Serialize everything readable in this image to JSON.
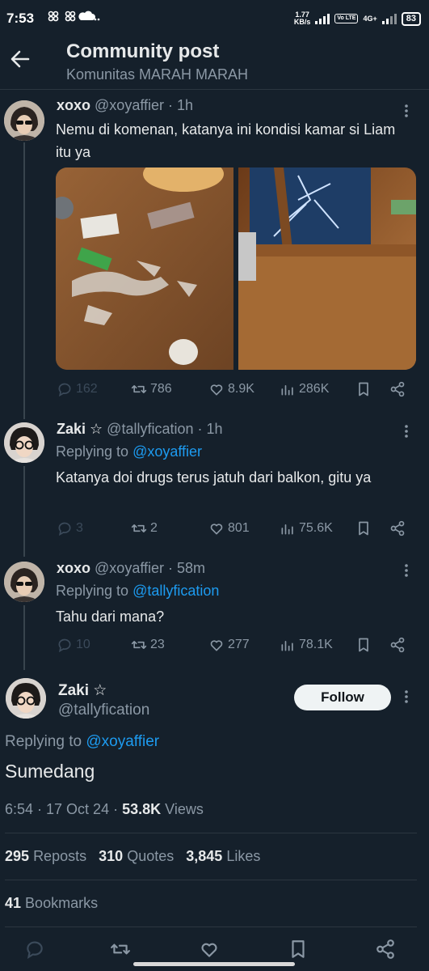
{
  "status_bar": {
    "time": "7:53",
    "speed_value": "1.77",
    "speed_unit": "KB/s",
    "network": "4G+",
    "volte": "Vo LTE",
    "battery": "83"
  },
  "header": {
    "title": "Community post",
    "subtitle": "Komunitas MARAH MARAH"
  },
  "posts": [
    {
      "name": "xoxo",
      "handle": "@xoyaffier",
      "time": "· 1h",
      "text": "Nemu di komenan, katanya ini kondisi kamar si Liam itu ya",
      "stats": {
        "replies": "162",
        "reposts": "786",
        "likes": "8.9K",
        "views": "286K"
      }
    },
    {
      "name": "Zaki ☆",
      "handle": "@tallyfication",
      "time": "· 1h",
      "replying_label": "Replying to",
      "replying_to": "@xoyaffier",
      "text": "Katanya doi drugs terus jatuh dari balkon, gitu ya",
      "stats": {
        "replies": "3",
        "reposts": "2",
        "likes": "801",
        "views": "75.6K"
      }
    },
    {
      "name": "xoxo",
      "handle": "@xoyaffier",
      "time": "· 58m",
      "replying_label": "Replying to",
      "replying_to": "@tallyfication",
      "text": "Tahu dari mana?",
      "stats": {
        "replies": "10",
        "reposts": "23",
        "likes": "277",
        "views": "78.1K"
      }
    }
  ],
  "main_post": {
    "name": "Zaki ☆",
    "handle": "@tallyfication",
    "follow_label": "Follow",
    "replying_label": "Replying to",
    "replying_to": "@xoyaffier",
    "text": "Sumedang",
    "timestamp": "6:54 · 17 Oct 24 ·",
    "views_count": "53.8K",
    "views_label": "Views",
    "reposts_count": "295",
    "reposts_label": "Reposts",
    "quotes_count": "310",
    "quotes_label": "Quotes",
    "likes_count": "3,845",
    "likes_label": "Likes",
    "bookmarks_count": "41",
    "bookmarks_label": "Bookmarks"
  },
  "icons": {
    "back": "arrow-left-icon",
    "reply": "reply-icon",
    "repost": "repost-icon",
    "like": "heart-icon",
    "views": "views-icon",
    "bookmark": "bookmark-icon",
    "share": "share-icon",
    "more": "more-vertical-icon"
  },
  "colors": {
    "background": "#15202b",
    "accent": "#1d9bf0",
    "muted": "#8b98a5",
    "text": "#e7e9ea"
  }
}
